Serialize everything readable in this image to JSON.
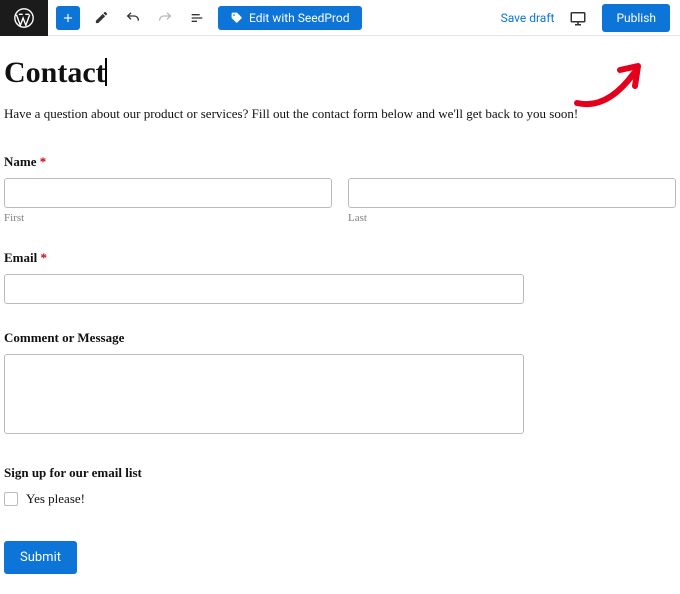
{
  "colors": {
    "accent": "#0c75d7",
    "required": "#c00"
  },
  "toolbar": {
    "seedprod_label": "Edit with SeedProd",
    "save_draft": "Save draft",
    "publish": "Publish"
  },
  "page": {
    "title": "Contact",
    "intro": "Have a question about our product or services? Fill out the contact form below and we'll get back to you soon!"
  },
  "form": {
    "name": {
      "label": "Name",
      "required": "*",
      "first_sub": "First",
      "last_sub": "Last"
    },
    "email": {
      "label": "Email",
      "required": "*"
    },
    "comment": {
      "label": "Comment or Message"
    },
    "signup": {
      "label": "Sign up for our email list",
      "option": "Yes please!"
    },
    "submit": "Submit"
  }
}
